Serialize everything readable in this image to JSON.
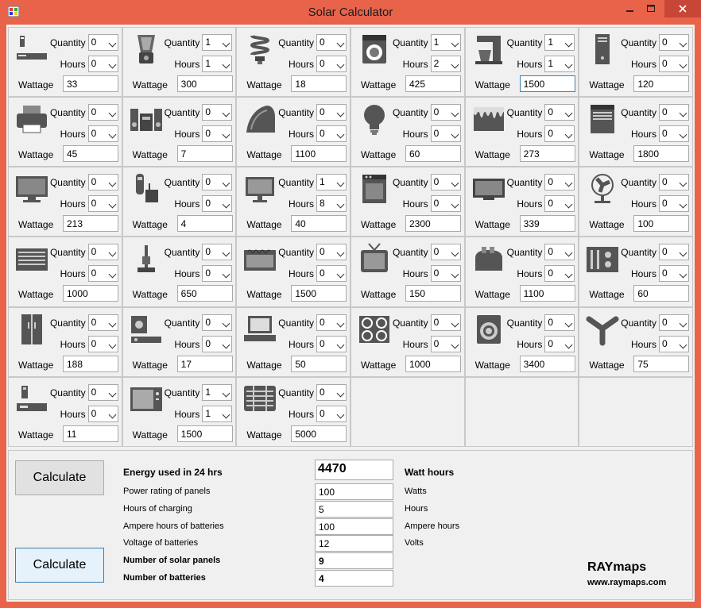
{
  "window": {
    "title": "Solar Calculator"
  },
  "labels": {
    "quantity": "Quantity",
    "hours": "Hours",
    "wattage": "Wattage"
  },
  "appliances": [
    {
      "icon": "dvd-player-icon",
      "quantity": "0",
      "hours": "0",
      "wattage": "33"
    },
    {
      "icon": "blender-icon",
      "quantity": "1",
      "hours": "1",
      "wattage": "300"
    },
    {
      "icon": "cfl-bulb-icon",
      "quantity": "0",
      "hours": "0",
      "wattage": "18"
    },
    {
      "icon": "washing-machine-icon",
      "quantity": "1",
      "hours": "2",
      "wattage": "425"
    },
    {
      "icon": "coffee-maker-icon",
      "quantity": "1",
      "hours": "1",
      "wattage": "1500",
      "focused": true
    },
    {
      "icon": "desktop-tower-icon",
      "quantity": "0",
      "hours": "0",
      "wattage": "120"
    },
    {
      "icon": "printer-icon",
      "quantity": "0",
      "hours": "0",
      "wattage": "45"
    },
    {
      "icon": "stereo-speakers-icon",
      "quantity": "0",
      "hours": "0",
      "wattage": "7"
    },
    {
      "icon": "clothes-iron-icon",
      "quantity": "0",
      "hours": "0",
      "wattage": "1100"
    },
    {
      "icon": "light-bulb-icon",
      "quantity": "0",
      "hours": "0",
      "wattage": "60"
    },
    {
      "icon": "freezer-icon",
      "quantity": "0",
      "hours": "0",
      "wattage": "273"
    },
    {
      "icon": "dishwasher-icon",
      "quantity": "0",
      "hours": "0",
      "wattage": "1800"
    },
    {
      "icon": "tv-icon",
      "quantity": "0",
      "hours": "0",
      "wattage": "213"
    },
    {
      "icon": "cordless-phone-icon",
      "quantity": "0",
      "hours": "0",
      "wattage": "4"
    },
    {
      "icon": "monitor-icon",
      "quantity": "1",
      "hours": "8",
      "wattage": "40"
    },
    {
      "icon": "stove-icon",
      "quantity": "0",
      "hours": "0",
      "wattage": "2300"
    },
    {
      "icon": "flat-screen-tv-icon",
      "quantity": "0",
      "hours": "0",
      "wattage": "339"
    },
    {
      "icon": "desk-fan-icon",
      "quantity": "0",
      "hours": "0",
      "wattage": "100"
    },
    {
      "icon": "air-conditioner-icon",
      "quantity": "0",
      "hours": "0",
      "wattage": "1000"
    },
    {
      "icon": "vacuum-cleaner-icon",
      "quantity": "0",
      "hours": "0",
      "wattage": "650"
    },
    {
      "icon": "heater-icon",
      "quantity": "0",
      "hours": "0",
      "wattage": "1500"
    },
    {
      "icon": "old-tv-icon",
      "quantity": "0",
      "hours": "0",
      "wattage": "150"
    },
    {
      "icon": "toaster-icon",
      "quantity": "0",
      "hours": "0",
      "wattage": "1100"
    },
    {
      "icon": "audio-mixer-icon",
      "quantity": "0",
      "hours": "0",
      "wattage": "60"
    },
    {
      "icon": "refrigerator-icon",
      "quantity": "0",
      "hours": "0",
      "wattage": "188"
    },
    {
      "icon": "music-player-icon",
      "quantity": "0",
      "hours": "0",
      "wattage": "17"
    },
    {
      "icon": "laptop-icon",
      "quantity": "0",
      "hours": "0",
      "wattage": "50"
    },
    {
      "icon": "cooktop-icon",
      "quantity": "0",
      "hours": "0",
      "wattage": "1000"
    },
    {
      "icon": "dryer-icon",
      "quantity": "0",
      "hours": "0",
      "wattage": "3400"
    },
    {
      "icon": "ceiling-fan-icon",
      "quantity": "0",
      "hours": "0",
      "wattage": "75"
    },
    {
      "icon": "set-top-box-icon",
      "quantity": "0",
      "hours": "0",
      "wattage": "11"
    },
    {
      "icon": "microwave-icon",
      "quantity": "1",
      "hours": "1",
      "wattage": "1500"
    },
    {
      "icon": "water-heater-icon",
      "quantity": "0",
      "hours": "0",
      "wattage": "5000"
    }
  ],
  "results": {
    "calculate_label": "Calculate",
    "energy_label": "Energy used in 24 hrs",
    "energy_value": "4470",
    "energy_unit": "Watt hours",
    "power_label": "Power rating of panels",
    "power_value": "100",
    "power_unit": "Watts",
    "charging_label": "Hours of charging",
    "charging_value": "5",
    "charging_unit": "Hours",
    "ampere_label": "Ampere hours of batteries",
    "ampere_value": "100",
    "ampere_unit": "Ampere hours",
    "voltage_label": "Voltage of batteries",
    "voltage_value": "12",
    "voltage_unit": "Volts",
    "panels_label": "Number of solar panels",
    "panels_value": "9",
    "batteries_label": "Number of batteries",
    "batteries_value": "4"
  },
  "brand": {
    "name": "RAYmaps",
    "url": "www.raymaps.com"
  }
}
